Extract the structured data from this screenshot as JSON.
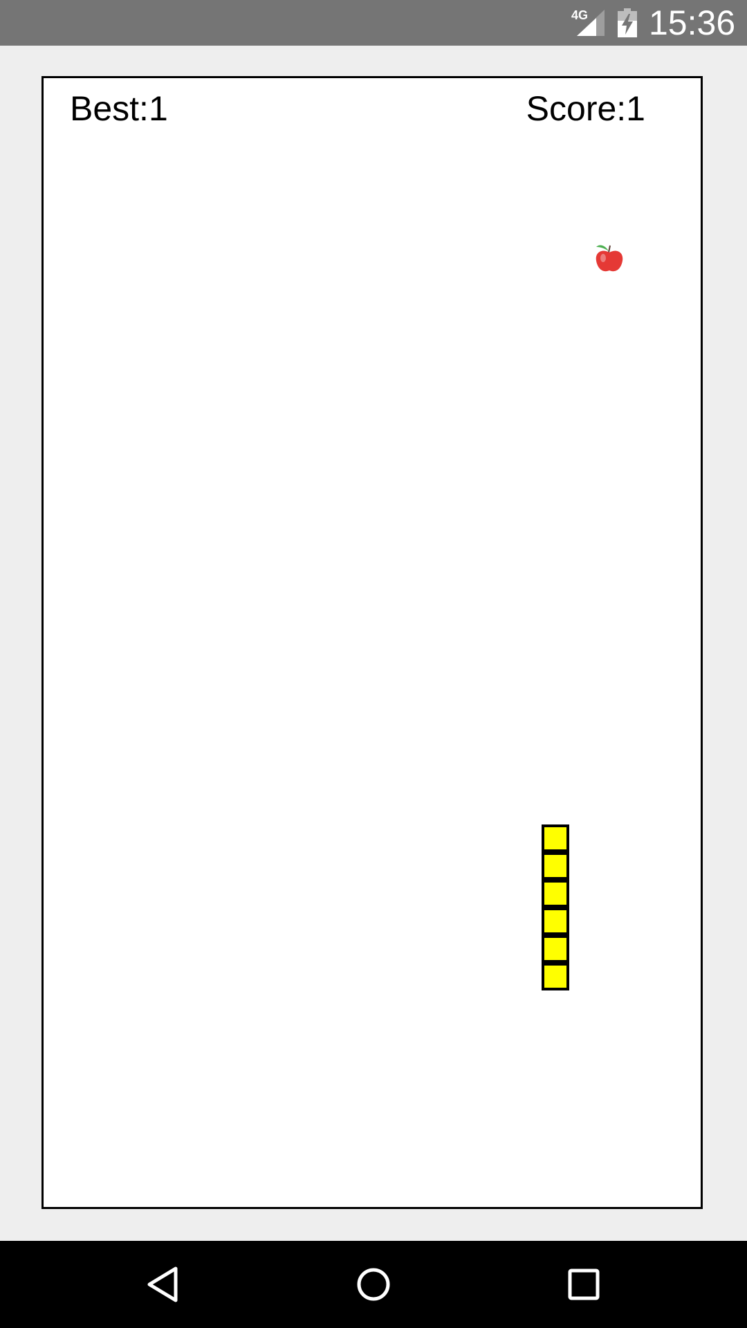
{
  "status_bar": {
    "network": "4G",
    "time": "15:36",
    "signal_icon": "signal-icon",
    "battery_icon": "battery-charging-icon"
  },
  "game": {
    "best_label": "Best:1",
    "score_label": "Score:1",
    "apple_icon": "apple-icon",
    "snake": {
      "color": "#ffff00",
      "outline_color": "#000000",
      "segment_count": 6
    }
  },
  "nav_bar": {
    "back_icon": "back-triangle-icon",
    "home_icon": "home-circle-icon",
    "recents_icon": "recents-square-icon"
  }
}
